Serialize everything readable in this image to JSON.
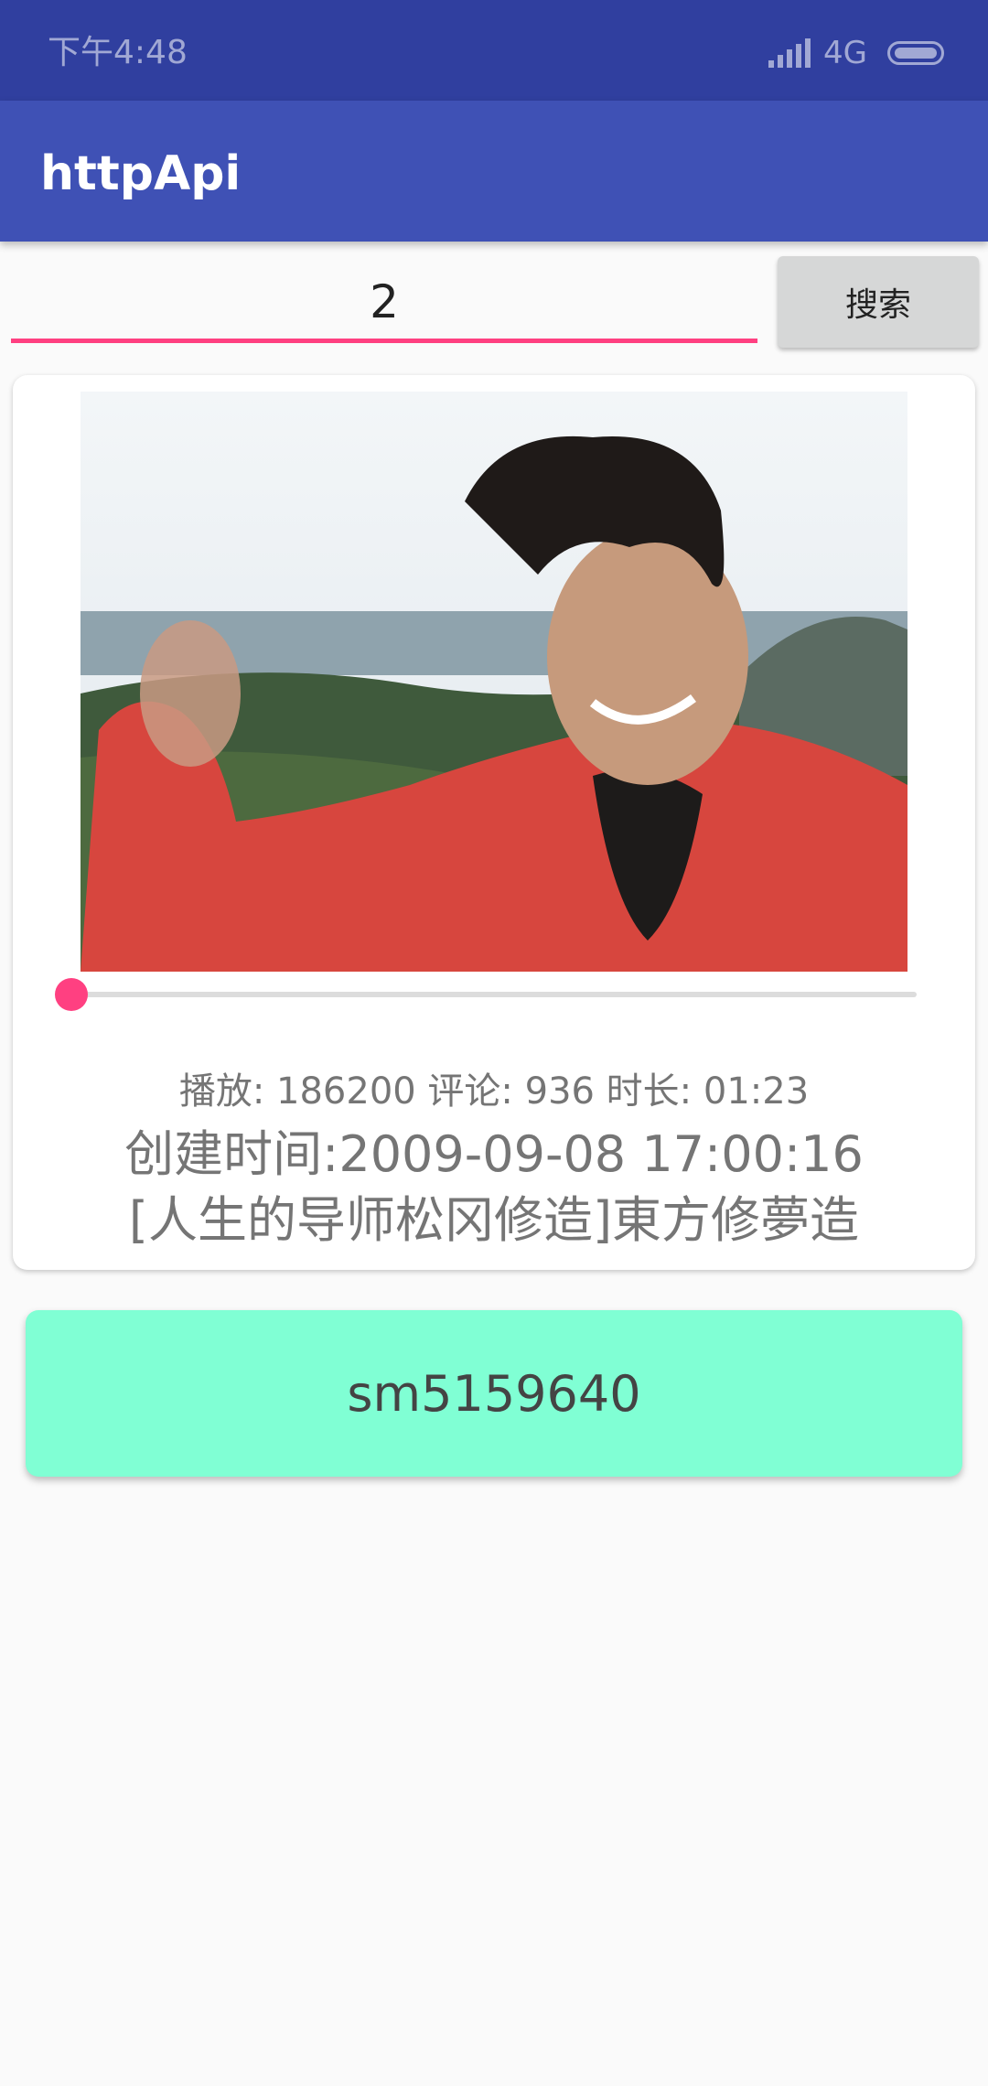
{
  "status_bar": {
    "time": "下午4:48",
    "network": "4G",
    "icons": [
      "signal-icon",
      "battery-icon"
    ]
  },
  "app_bar": {
    "title": "httpApi"
  },
  "search": {
    "value": "2",
    "button_label": "搜索"
  },
  "video": {
    "stats": "播放: 186200 评论: 936 时长: 01:23",
    "created": "创建时间:2009-09-08 17:00:16",
    "title": "[人生的导师松冈修造]東方修夢造",
    "seek_progress": 0.0
  },
  "id_button": {
    "label": "sm5159640"
  },
  "colors": {
    "status_bar": "#303f9f",
    "primary": "#3f51b5",
    "accent": "#ff4081",
    "id_button_bg": "#80ffd4"
  }
}
